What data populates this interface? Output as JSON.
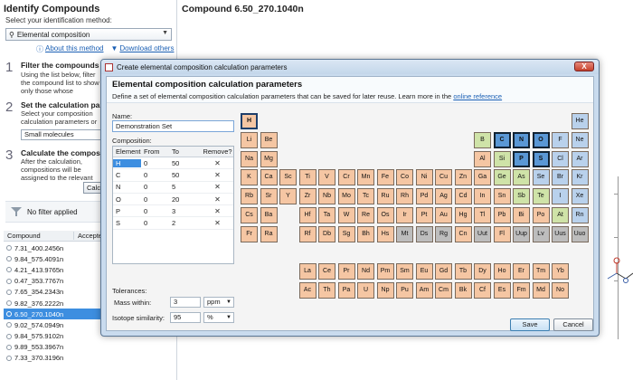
{
  "left_panel": {
    "title": "Identify Compounds",
    "subtitle": "Select your identification method:",
    "method": "Elemental composition",
    "links": [
      "About this method",
      "Download others"
    ],
    "steps": [
      {
        "num": "1",
        "title": "Filter the compounds",
        "text": "Using the list below, filter the compound list to show only those whose composition you wish to calculate."
      },
      {
        "num": "2",
        "title": "Set the calculation parameters",
        "text": "Select your composition calculation parameters or create a new parameter set."
      },
      {
        "num": "3",
        "title": "Calculate the compositions",
        "text": "After the calculation, compositions will be assigned to the relevant compounds automatically."
      }
    ],
    "step1_link": "filter",
    "param_select": "Small molecules",
    "calculate_btn": "Calculate",
    "filter_text": "No filter applied",
    "list_headers": [
      "Compound",
      "Accepted"
    ],
    "compounds": [
      "7.31_400.2456n",
      "9.84_575.4091n",
      "4.21_413.9765n",
      "0.47_353.7767n",
      "7.65_354.2343n",
      "9.82_376.2222n",
      "6.50_270.1040n",
      "9.02_574.0949n",
      "9.84_575.9102n",
      "9.89_553.3967n",
      "7.33_370.3196n"
    ],
    "selected_compound": "6.50_270.1040n"
  },
  "right": {
    "title": "Compound 6.50_270.1040n"
  },
  "dialog": {
    "title": "Create elemental composition calculation parameters",
    "header_title": "Elemental composition calculation parameters",
    "header_desc": "Define a set of elemental composition calculation parameters that can be saved for later reuse. Learn more in the",
    "header_link": "online reference",
    "name_label": "Name:",
    "name_value": "Demonstration Set",
    "composition_label": "Composition:",
    "table_headers": [
      "Element",
      "From",
      "To",
      "Remove?"
    ],
    "rows": [
      {
        "el": "H",
        "from": "0",
        "to": "50"
      },
      {
        "el": "C",
        "from": "0",
        "to": "50"
      },
      {
        "el": "N",
        "from": "0",
        "to": "5"
      },
      {
        "el": "O",
        "from": "0",
        "to": "20"
      },
      {
        "el": "P",
        "from": "0",
        "to": "3"
      },
      {
        "el": "S",
        "from": "0",
        "to": "2"
      }
    ],
    "remove_glyph": "✕",
    "tolerances_label": "Tolerances:",
    "mass_label": "Mass within:",
    "mass_value": "3",
    "mass_unit": "ppm",
    "iso_label": "Isotope similarity:",
    "iso_value": "95",
    "iso_unit": "%",
    "save": "Save",
    "cancel": "Cancel",
    "close_glyph": "X"
  },
  "colors": {
    "nonmetal": "#a7c4e4",
    "metal": "#f5c6a3",
    "metalloid": "#cfe3a8",
    "halogen": "#b9d1ec",
    "noble": "#b9d1ec",
    "unknown": "#bdbdbd",
    "selected": "#5a97d5",
    "lanth": "#f5c6a3"
  },
  "periodic_table": [
    {
      "s": "H",
      "r": 0,
      "c": 0,
      "t": "sel"
    },
    {
      "s": "He",
      "r": 0,
      "c": 17,
      "t": "noble"
    },
    {
      "s": "Li",
      "r": 1,
      "c": 0,
      "t": "metal"
    },
    {
      "s": "Be",
      "r": 1,
      "c": 1,
      "t": "metal"
    },
    {
      "s": "B",
      "r": 1,
      "c": 12,
      "t": "metalloid"
    },
    {
      "s": "C",
      "r": 1,
      "c": 13,
      "t": "dark"
    },
    {
      "s": "N",
      "r": 1,
      "c": 14,
      "t": "dark"
    },
    {
      "s": "O",
      "r": 1,
      "c": 15,
      "t": "dark"
    },
    {
      "s": "F",
      "r": 1,
      "c": 16,
      "t": "halogen"
    },
    {
      "s": "Ne",
      "r": 1,
      "c": 17,
      "t": "noble"
    },
    {
      "s": "Na",
      "r": 2,
      "c": 0,
      "t": "metal"
    },
    {
      "s": "Mg",
      "r": 2,
      "c": 1,
      "t": "metal"
    },
    {
      "s": "Al",
      "r": 2,
      "c": 12,
      "t": "metal"
    },
    {
      "s": "Si",
      "r": 2,
      "c": 13,
      "t": "metalloid"
    },
    {
      "s": "P",
      "r": 2,
      "c": 14,
      "t": "dark"
    },
    {
      "s": "S",
      "r": 2,
      "c": 15,
      "t": "dark"
    },
    {
      "s": "Cl",
      "r": 2,
      "c": 16,
      "t": "halogen"
    },
    {
      "s": "Ar",
      "r": 2,
      "c": 17,
      "t": "noble"
    },
    {
      "s": "K",
      "r": 3,
      "c": 0,
      "t": "metal"
    },
    {
      "s": "Ca",
      "r": 3,
      "c": 1,
      "t": "metal"
    },
    {
      "s": "Sc",
      "r": 3,
      "c": 2,
      "t": "metal"
    },
    {
      "s": "Ti",
      "r": 3,
      "c": 3,
      "t": "metal"
    },
    {
      "s": "V",
      "r": 3,
      "c": 4,
      "t": "metal"
    },
    {
      "s": "Cr",
      "r": 3,
      "c": 5,
      "t": "metal"
    },
    {
      "s": "Mn",
      "r": 3,
      "c": 6,
      "t": "metal"
    },
    {
      "s": "Fe",
      "r": 3,
      "c": 7,
      "t": "metal"
    },
    {
      "s": "Co",
      "r": 3,
      "c": 8,
      "t": "metal"
    },
    {
      "s": "Ni",
      "r": 3,
      "c": 9,
      "t": "metal"
    },
    {
      "s": "Cu",
      "r": 3,
      "c": 10,
      "t": "metal"
    },
    {
      "s": "Zn",
      "r": 3,
      "c": 11,
      "t": "metal"
    },
    {
      "s": "Ga",
      "r": 3,
      "c": 12,
      "t": "metal"
    },
    {
      "s": "Ge",
      "r": 3,
      "c": 13,
      "t": "metalloid"
    },
    {
      "s": "As",
      "r": 3,
      "c": 14,
      "t": "metalloid"
    },
    {
      "s": "Se",
      "r": 3,
      "c": 15,
      "t": "halogen"
    },
    {
      "s": "Br",
      "r": 3,
      "c": 16,
      "t": "halogen"
    },
    {
      "s": "Kr",
      "r": 3,
      "c": 17,
      "t": "noble"
    },
    {
      "s": "Rb",
      "r": 4,
      "c": 0,
      "t": "metal"
    },
    {
      "s": "Sr",
      "r": 4,
      "c": 1,
      "t": "metal"
    },
    {
      "s": "Y",
      "r": 4,
      "c": 2,
      "t": "metal"
    },
    {
      "s": "Zr",
      "r": 4,
      "c": 3,
      "t": "metal"
    },
    {
      "s": "Nb",
      "r": 4,
      "c": 4,
      "t": "metal"
    },
    {
      "s": "Mo",
      "r": 4,
      "c": 5,
      "t": "metal"
    },
    {
      "s": "Tc",
      "r": 4,
      "c": 6,
      "t": "metal"
    },
    {
      "s": "Ru",
      "r": 4,
      "c": 7,
      "t": "metal"
    },
    {
      "s": "Rh",
      "r": 4,
      "c": 8,
      "t": "metal"
    },
    {
      "s": "Pd",
      "r": 4,
      "c": 9,
      "t": "metal"
    },
    {
      "s": "Ag",
      "r": 4,
      "c": 10,
      "t": "metal"
    },
    {
      "s": "Cd",
      "r": 4,
      "c": 11,
      "t": "metal"
    },
    {
      "s": "In",
      "r": 4,
      "c": 12,
      "t": "metal"
    },
    {
      "s": "Sn",
      "r": 4,
      "c": 13,
      "t": "metal"
    },
    {
      "s": "Sb",
      "r": 4,
      "c": 14,
      "t": "metalloid"
    },
    {
      "s": "Te",
      "r": 4,
      "c": 15,
      "t": "metalloid"
    },
    {
      "s": "I",
      "r": 4,
      "c": 16,
      "t": "halogen"
    },
    {
      "s": "Xe",
      "r": 4,
      "c": 17,
      "t": "noble"
    },
    {
      "s": "Cs",
      "r": 5,
      "c": 0,
      "t": "metal"
    },
    {
      "s": "Ba",
      "r": 5,
      "c": 1,
      "t": "metal"
    },
    {
      "s": "Hf",
      "r": 5,
      "c": 3,
      "t": "metal"
    },
    {
      "s": "Ta",
      "r": 5,
      "c": 4,
      "t": "metal"
    },
    {
      "s": "W",
      "r": 5,
      "c": 5,
      "t": "metal"
    },
    {
      "s": "Re",
      "r": 5,
      "c": 6,
      "t": "metal"
    },
    {
      "s": "Os",
      "r": 5,
      "c": 7,
      "t": "metal"
    },
    {
      "s": "Ir",
      "r": 5,
      "c": 8,
      "t": "metal"
    },
    {
      "s": "Pt",
      "r": 5,
      "c": 9,
      "t": "metal"
    },
    {
      "s": "Au",
      "r": 5,
      "c": 10,
      "t": "metal"
    },
    {
      "s": "Hg",
      "r": 5,
      "c": 11,
      "t": "metal"
    },
    {
      "s": "Tl",
      "r": 5,
      "c": 12,
      "t": "metal"
    },
    {
      "s": "Pb",
      "r": 5,
      "c": 13,
      "t": "metal"
    },
    {
      "s": "Bi",
      "r": 5,
      "c": 14,
      "t": "metal"
    },
    {
      "s": "Po",
      "r": 5,
      "c": 15,
      "t": "metal"
    },
    {
      "s": "At",
      "r": 5,
      "c": 16,
      "t": "metalloid"
    },
    {
      "s": "Rn",
      "r": 5,
      "c": 17,
      "t": "noble"
    },
    {
      "s": "Fr",
      "r": 6,
      "c": 0,
      "t": "metal"
    },
    {
      "s": "Ra",
      "r": 6,
      "c": 1,
      "t": "metal"
    },
    {
      "s": "Rf",
      "r": 6,
      "c": 3,
      "t": "metal"
    },
    {
      "s": "Db",
      "r": 6,
      "c": 4,
      "t": "metal"
    },
    {
      "s": "Sg",
      "r": 6,
      "c": 5,
      "t": "metal"
    },
    {
      "s": "Bh",
      "r": 6,
      "c": 6,
      "t": "metal"
    },
    {
      "s": "Hs",
      "r": 6,
      "c": 7,
      "t": "metal"
    },
    {
      "s": "Mt",
      "r": 6,
      "c": 8,
      "t": "unknown"
    },
    {
      "s": "Ds",
      "r": 6,
      "c": 9,
      "t": "unknown"
    },
    {
      "s": "Rg",
      "r": 6,
      "c": 10,
      "t": "unknown"
    },
    {
      "s": "Cn",
      "r": 6,
      "c": 11,
      "t": "metal"
    },
    {
      "s": "Uut",
      "r": 6,
      "c": 12,
      "t": "unknown"
    },
    {
      "s": "Fl",
      "r": 6,
      "c": 13,
      "t": "metal"
    },
    {
      "s": "Uup",
      "r": 6,
      "c": 14,
      "t": "unknown"
    },
    {
      "s": "Lv",
      "r": 6,
      "c": 15,
      "t": "unknown"
    },
    {
      "s": "Uus",
      "r": 6,
      "c": 16,
      "t": "unknown"
    },
    {
      "s": "Uuo",
      "r": 6,
      "c": 17,
      "t": "unknown"
    },
    {
      "s": "La",
      "r": 8,
      "c": 3,
      "t": "lanth"
    },
    {
      "s": "Ce",
      "r": 8,
      "c": 4,
      "t": "lanth"
    },
    {
      "s": "Pr",
      "r": 8,
      "c": 5,
      "t": "lanth"
    },
    {
      "s": "Nd",
      "r": 8,
      "c": 6,
      "t": "lanth"
    },
    {
      "s": "Pm",
      "r": 8,
      "c": 7,
      "t": "lanth"
    },
    {
      "s": "Sm",
      "r": 8,
      "c": 8,
      "t": "lanth"
    },
    {
      "s": "Eu",
      "r": 8,
      "c": 9,
      "t": "lanth"
    },
    {
      "s": "Gd",
      "r": 8,
      "c": 10,
      "t": "lanth"
    },
    {
      "s": "Tb",
      "r": 8,
      "c": 11,
      "t": "lanth"
    },
    {
      "s": "Dy",
      "r": 8,
      "c": 12,
      "t": "lanth"
    },
    {
      "s": "Ho",
      "r": 8,
      "c": 13,
      "t": "lanth"
    },
    {
      "s": "Er",
      "r": 8,
      "c": 14,
      "t": "lanth"
    },
    {
      "s": "Tm",
      "r": 8,
      "c": 15,
      "t": "lanth"
    },
    {
      "s": "Yb",
      "r": 8,
      "c": 16,
      "t": "lanth"
    },
    {
      "s": "Ac",
      "r": 9,
      "c": 3,
      "t": "lanth"
    },
    {
      "s": "Th",
      "r": 9,
      "c": 4,
      "t": "lanth"
    },
    {
      "s": "Pa",
      "r": 9,
      "c": 5,
      "t": "lanth"
    },
    {
      "s": "U",
      "r": 9,
      "c": 6,
      "t": "lanth"
    },
    {
      "s": "Np",
      "r": 9,
      "c": 7,
      "t": "lanth"
    },
    {
      "s": "Pu",
      "r": 9,
      "c": 8,
      "t": "lanth"
    },
    {
      "s": "Am",
      "r": 9,
      "c": 9,
      "t": "lanth"
    },
    {
      "s": "Cm",
      "r": 9,
      "c": 10,
      "t": "lanth"
    },
    {
      "s": "Bk",
      "r": 9,
      "c": 11,
      "t": "lanth"
    },
    {
      "s": "Cf",
      "r": 9,
      "c": 12,
      "t": "lanth"
    },
    {
      "s": "Es",
      "r": 9,
      "c": 13,
      "t": "lanth"
    },
    {
      "s": "Fm",
      "r": 9,
      "c": 14,
      "t": "lanth"
    },
    {
      "s": "Md",
      "r": 9,
      "c": 15,
      "t": "lanth"
    },
    {
      "s": "No",
      "r": 9,
      "c": 16,
      "t": "lanth"
    }
  ]
}
